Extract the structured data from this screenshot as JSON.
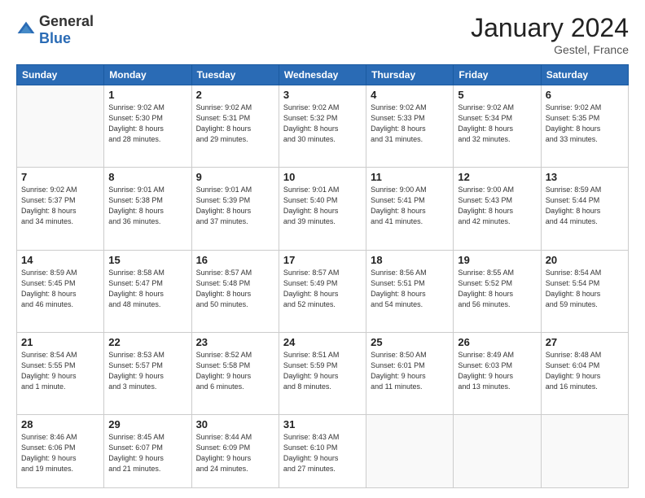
{
  "header": {
    "logo_general": "General",
    "logo_blue": "Blue",
    "title": "January 2024",
    "location": "Gestel, France"
  },
  "weekdays": [
    "Sunday",
    "Monday",
    "Tuesday",
    "Wednesday",
    "Thursday",
    "Friday",
    "Saturday"
  ],
  "weeks": [
    [
      {
        "day": "",
        "detail": ""
      },
      {
        "day": "1",
        "detail": "Sunrise: 9:02 AM\nSunset: 5:30 PM\nDaylight: 8 hours\nand 28 minutes."
      },
      {
        "day": "2",
        "detail": "Sunrise: 9:02 AM\nSunset: 5:31 PM\nDaylight: 8 hours\nand 29 minutes."
      },
      {
        "day": "3",
        "detail": "Sunrise: 9:02 AM\nSunset: 5:32 PM\nDaylight: 8 hours\nand 30 minutes."
      },
      {
        "day": "4",
        "detail": "Sunrise: 9:02 AM\nSunset: 5:33 PM\nDaylight: 8 hours\nand 31 minutes."
      },
      {
        "day": "5",
        "detail": "Sunrise: 9:02 AM\nSunset: 5:34 PM\nDaylight: 8 hours\nand 32 minutes."
      },
      {
        "day": "6",
        "detail": "Sunrise: 9:02 AM\nSunset: 5:35 PM\nDaylight: 8 hours\nand 33 minutes."
      }
    ],
    [
      {
        "day": "7",
        "detail": "Sunrise: 9:02 AM\nSunset: 5:37 PM\nDaylight: 8 hours\nand 34 minutes."
      },
      {
        "day": "8",
        "detail": "Sunrise: 9:01 AM\nSunset: 5:38 PM\nDaylight: 8 hours\nand 36 minutes."
      },
      {
        "day": "9",
        "detail": "Sunrise: 9:01 AM\nSunset: 5:39 PM\nDaylight: 8 hours\nand 37 minutes."
      },
      {
        "day": "10",
        "detail": "Sunrise: 9:01 AM\nSunset: 5:40 PM\nDaylight: 8 hours\nand 39 minutes."
      },
      {
        "day": "11",
        "detail": "Sunrise: 9:00 AM\nSunset: 5:41 PM\nDaylight: 8 hours\nand 41 minutes."
      },
      {
        "day": "12",
        "detail": "Sunrise: 9:00 AM\nSunset: 5:43 PM\nDaylight: 8 hours\nand 42 minutes."
      },
      {
        "day": "13",
        "detail": "Sunrise: 8:59 AM\nSunset: 5:44 PM\nDaylight: 8 hours\nand 44 minutes."
      }
    ],
    [
      {
        "day": "14",
        "detail": "Sunrise: 8:59 AM\nSunset: 5:45 PM\nDaylight: 8 hours\nand 46 minutes."
      },
      {
        "day": "15",
        "detail": "Sunrise: 8:58 AM\nSunset: 5:47 PM\nDaylight: 8 hours\nand 48 minutes."
      },
      {
        "day": "16",
        "detail": "Sunrise: 8:57 AM\nSunset: 5:48 PM\nDaylight: 8 hours\nand 50 minutes."
      },
      {
        "day": "17",
        "detail": "Sunrise: 8:57 AM\nSunset: 5:49 PM\nDaylight: 8 hours\nand 52 minutes."
      },
      {
        "day": "18",
        "detail": "Sunrise: 8:56 AM\nSunset: 5:51 PM\nDaylight: 8 hours\nand 54 minutes."
      },
      {
        "day": "19",
        "detail": "Sunrise: 8:55 AM\nSunset: 5:52 PM\nDaylight: 8 hours\nand 56 minutes."
      },
      {
        "day": "20",
        "detail": "Sunrise: 8:54 AM\nSunset: 5:54 PM\nDaylight: 8 hours\nand 59 minutes."
      }
    ],
    [
      {
        "day": "21",
        "detail": "Sunrise: 8:54 AM\nSunset: 5:55 PM\nDaylight: 9 hours\nand 1 minute."
      },
      {
        "day": "22",
        "detail": "Sunrise: 8:53 AM\nSunset: 5:57 PM\nDaylight: 9 hours\nand 3 minutes."
      },
      {
        "day": "23",
        "detail": "Sunrise: 8:52 AM\nSunset: 5:58 PM\nDaylight: 9 hours\nand 6 minutes."
      },
      {
        "day": "24",
        "detail": "Sunrise: 8:51 AM\nSunset: 5:59 PM\nDaylight: 9 hours\nand 8 minutes."
      },
      {
        "day": "25",
        "detail": "Sunrise: 8:50 AM\nSunset: 6:01 PM\nDaylight: 9 hours\nand 11 minutes."
      },
      {
        "day": "26",
        "detail": "Sunrise: 8:49 AM\nSunset: 6:03 PM\nDaylight: 9 hours\nand 13 minutes."
      },
      {
        "day": "27",
        "detail": "Sunrise: 8:48 AM\nSunset: 6:04 PM\nDaylight: 9 hours\nand 16 minutes."
      }
    ],
    [
      {
        "day": "28",
        "detail": "Sunrise: 8:46 AM\nSunset: 6:06 PM\nDaylight: 9 hours\nand 19 minutes."
      },
      {
        "day": "29",
        "detail": "Sunrise: 8:45 AM\nSunset: 6:07 PM\nDaylight: 9 hours\nand 21 minutes."
      },
      {
        "day": "30",
        "detail": "Sunrise: 8:44 AM\nSunset: 6:09 PM\nDaylight: 9 hours\nand 24 minutes."
      },
      {
        "day": "31",
        "detail": "Sunrise: 8:43 AM\nSunset: 6:10 PM\nDaylight: 9 hours\nand 27 minutes."
      },
      {
        "day": "",
        "detail": ""
      },
      {
        "day": "",
        "detail": ""
      },
      {
        "day": "",
        "detail": ""
      }
    ]
  ]
}
